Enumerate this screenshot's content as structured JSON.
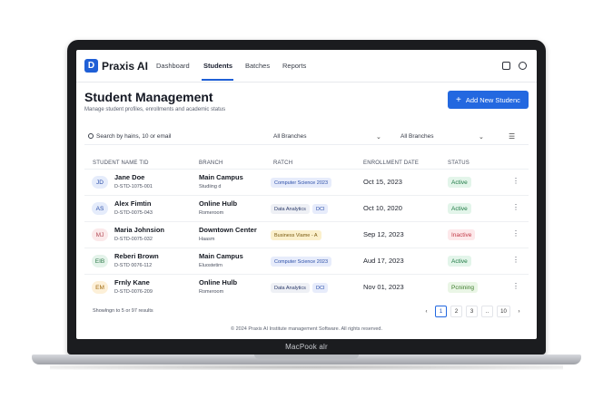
{
  "device": {
    "label": "MacPook alr"
  },
  "nav": {
    "logo_letter": "D",
    "brand": "Praxis AI",
    "links": [
      "Dashboard",
      "Students",
      "Batches",
      "Reports"
    ],
    "active": "Students"
  },
  "header": {
    "title": "Student Management",
    "subtitle": "Manage student profiles, enrollments and academic status",
    "add_button": "Add New Studenc"
  },
  "filters": {
    "search_placeholder": "Search by hains, 10 or email",
    "branch_select_1": "All Branches",
    "branch_select_2": "All Branches"
  },
  "table": {
    "headers": [
      "STUDENT NAME TID",
      "BRANCH",
      "RATCH",
      "ENROLLMENT DATE",
      "STATUS"
    ],
    "rows": [
      {
        "initials": "JD",
        "name": "Jane Doe",
        "id": "D-STD-1075-001",
        "branch": "Main Campus",
        "branch_sub": "Studiing d",
        "batch": "Computer Science 2023",
        "batch2": "",
        "date": "Oct 15, 2023",
        "status": "Active"
      },
      {
        "initials": "AS",
        "name": "Alex Fimtin",
        "id": "D-STD-0075-043",
        "branch": "Online Hulb",
        "branch_sub": "Romeroom",
        "batch": "Data Analytics",
        "batch2": "DCI",
        "date": "Oct 10, 2020",
        "status": "Active"
      },
      {
        "initials": "MJ",
        "name": "Maria Johnsion",
        "id": "D-STD-0075-032",
        "branch": "Downtown Center",
        "branch_sub": "Haasm",
        "batch": "Business Viame - A",
        "batch2": "",
        "date": "Sep 12, 2023",
        "status": "Inactive"
      },
      {
        "initials": "EIB",
        "name": "Reberi Brown",
        "id": "D-STD 0076-112",
        "branch": "Main Campus",
        "branch_sub": "Eluostetirn",
        "batch": "Computer Science 2023",
        "batch2": "",
        "date": "Aud 17, 2023",
        "status": "Active"
      },
      {
        "initials": "EM",
        "name": "Frnly Kane",
        "id": "D-STD-0076-209",
        "branch": "Online Hulb",
        "branch_sub": "Romeroom",
        "batch": "Data Analytics",
        "batch2": "DCI",
        "date": "Nov 01, 2023",
        "status": "Pcnining"
      }
    ]
  },
  "pagination": {
    "showing": "Showlngn to 5 or 97 results",
    "pages": [
      "‹",
      "1",
      "2",
      "3",
      "..",
      "10",
      "›"
    ],
    "active_page": "1"
  },
  "footer": {
    "copyright": "© 2024 Praxis AI Institute management Software. All rights reserved."
  },
  "colors": {
    "accent": "#2368e0",
    "active_status_bg": "#e3f5ea",
    "active_status_fg": "#1f7a45",
    "inactive_status_bg": "#fde8ea",
    "inactive_status_fg": "#c23a48",
    "pending_status_bg": "#eaf6e6",
    "pending_status_fg": "#3b7a2a"
  }
}
